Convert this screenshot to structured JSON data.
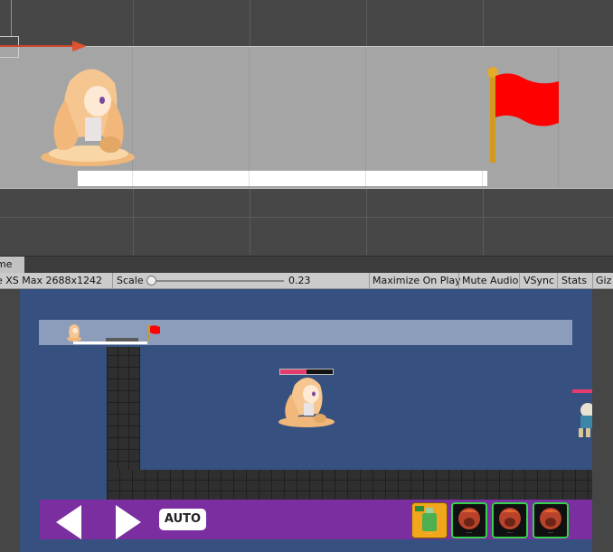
{
  "scene_view": {
    "characters": [
      "girl-character-sprite",
      "red-flag"
    ]
  },
  "game_view": {
    "tab_label": "me",
    "toolbar": {
      "resolution": "e XS Max 2688x1242 ↕",
      "scale_label": "Scale",
      "scale_value": "0.23",
      "maximize_on_play": "Maximize On Play",
      "mute_audio": "Mute Audio",
      "vsync": "VSync",
      "stats": "Stats",
      "gizmos": "Giz"
    },
    "hud": {
      "player_hp_fraction": 0.5,
      "auto_label": "AUTO"
    },
    "cards": [
      {
        "name": "potion-card",
        "caption": "····"
      },
      {
        "name": "skill-card-1",
        "caption": "····"
      },
      {
        "name": "skill-card-2",
        "caption": "····"
      },
      {
        "name": "skill-card-3",
        "caption": "····"
      }
    ]
  },
  "colors": {
    "flag": "#ff0000",
    "hp": "#e63b6e",
    "panel": "#7a2ea0",
    "card_border": "#33d34b",
    "sky": "#36517f"
  }
}
